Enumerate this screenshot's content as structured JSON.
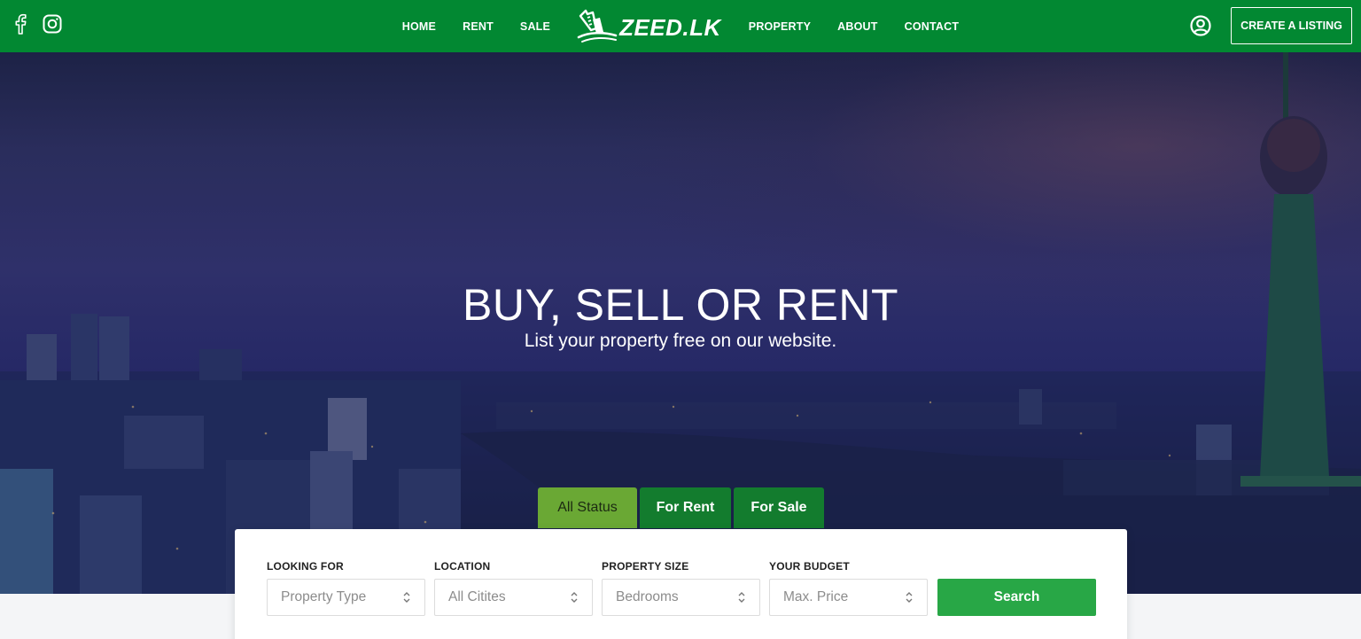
{
  "header": {
    "social": [
      {
        "name": "facebook-icon"
      },
      {
        "name": "instagram-icon"
      }
    ],
    "nav_left": [
      "HOME",
      "RENT",
      "SALE"
    ],
    "logo_text": "ZEED.LK",
    "nav_right": [
      "PROPERTY",
      "ABOUT",
      "CONTACT"
    ],
    "user_icon": "user-circle-icon",
    "cta_label": "CREATE A LISTING"
  },
  "hero": {
    "title": "BUY, SELL OR RENT",
    "subtitle": "List your property free on our website."
  },
  "tabs": [
    "All Status",
    "For Rent",
    "For Sale"
  ],
  "active_tab": "All Status",
  "search": {
    "fields": [
      {
        "label": "LOOKING FOR",
        "value": "Property Type"
      },
      {
        "label": "LOCATION",
        "value": "All Citites"
      },
      {
        "label": "PROPERTY SIZE",
        "value": "Bedrooms"
      },
      {
        "label": "YOUR BUDGET",
        "value": "Max. Price"
      }
    ],
    "button_label": "Search"
  },
  "colors": {
    "nav_bg": "#028832",
    "tab_active": "#6aa834",
    "tab_inactive": "#137c2e",
    "search_button": "#28a746"
  }
}
